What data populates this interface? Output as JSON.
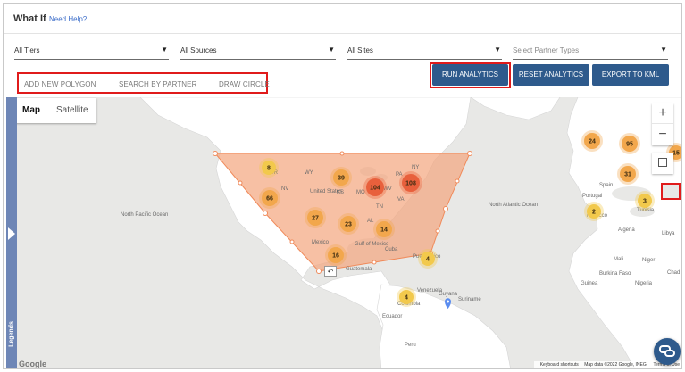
{
  "header": {
    "title": "What If",
    "help_link": "Need Help?"
  },
  "filters": [
    {
      "value": "All Tiers"
    },
    {
      "value": "All Sources"
    },
    {
      "value": "All Sites"
    },
    {
      "placeholder": "Select Partner Types"
    }
  ],
  "tools": {
    "add_polygon": "ADD NEW POLYGON",
    "search_partner": "SEARCH BY PARTNER",
    "draw_circle": "DRAW CIRCLE"
  },
  "actions": {
    "run": "RUN ANALYTICS",
    "reset": "RESET ANALYTICS",
    "export": "EXPORT TO KML"
  },
  "map": {
    "types": [
      "Map",
      "Satellite"
    ],
    "selected_type": "Map",
    "zoom_in": "+",
    "zoom_out": "−",
    "legends_label": "Legends",
    "google_logo": "Google",
    "attribution": {
      "shortcuts": "Keyboard shortcuts",
      "data": "Map data ©2022 Google, INEGI",
      "terms": "Terms of Use"
    },
    "place_labels": [
      "United States",
      "Mexico",
      "Cuba",
      "Guatemala",
      "North Pacific Ocean",
      "North Atlantic Ocean",
      "Venezuela",
      "Colombia",
      "Guyana",
      "Suriname",
      "Ecuador",
      "Peru",
      "Spain",
      "Portugal",
      "Algeria",
      "Libya",
      "Tunisia",
      "Morocco",
      "Mali",
      "Niger",
      "Guinea",
      "Nigeria",
      "Chad",
      "Burkina Faso",
      "Gulf of Mexico",
      "Puerto Rico",
      "OR",
      "NV",
      "WY",
      "KS",
      "MO",
      "TN",
      "WV",
      "NY",
      "PA",
      "AL",
      "VA"
    ],
    "clusters": [
      {
        "count": "8",
        "color": "#f2c94c"
      },
      {
        "count": "66",
        "color": "#f2a74c"
      },
      {
        "count": "39",
        "color": "#f2a74c"
      },
      {
        "count": "104",
        "color": "#e8603c"
      },
      {
        "count": "108",
        "color": "#e8603c"
      },
      {
        "count": "27",
        "color": "#f2a74c"
      },
      {
        "count": "23",
        "color": "#f2a74c"
      },
      {
        "count": "14",
        "color": "#f2a74c"
      },
      {
        "count": "16",
        "color": "#f2a74c"
      },
      {
        "count": "4",
        "color": "#f2c94c"
      },
      {
        "count": "4",
        "color": "#f2c94c"
      },
      {
        "count": "24",
        "color": "#f2a74c"
      },
      {
        "count": "95",
        "color": "#f2a74c"
      },
      {
        "count": "31",
        "color": "#f2a74c"
      },
      {
        "count": "3",
        "color": "#f2c94c"
      },
      {
        "count": "2",
        "color": "#f2c94c"
      },
      {
        "count": "15",
        "color": "#f2a74c"
      }
    ],
    "polygon_color": "#f4a57d",
    "land_color": "#ffffff",
    "water_color": "#e8e8e6"
  },
  "colors": {
    "accent": "#2e5a8c",
    "highlight": "#e01b1b",
    "link": "#3b6cc9"
  }
}
